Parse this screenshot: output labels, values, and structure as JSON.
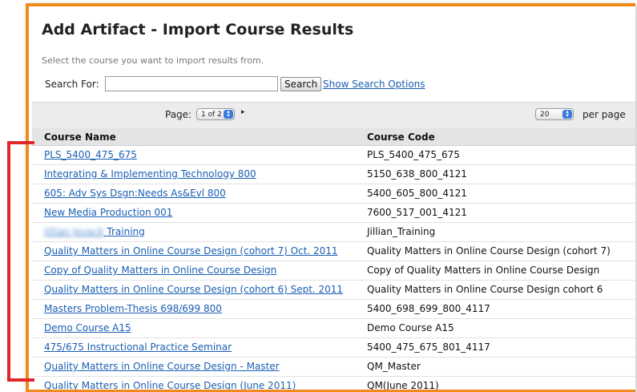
{
  "title": "Add Artifact - Import Course Results",
  "instructions": "Select the course you want to import results from.",
  "search": {
    "label": "Search For:",
    "value": "",
    "placeholder": "",
    "button_label": "Search",
    "options_link": "Show Search Options"
  },
  "pager": {
    "page_label": "Page:",
    "page_value": "1 of 2",
    "next_glyph": "▸",
    "per_page_value": "20",
    "per_page_label": "per page"
  },
  "table": {
    "columns": [
      "Course Name",
      "Course Code"
    ],
    "rows": [
      {
        "name": "PLS_5400_475_675",
        "code": "PLS_5400_475_675"
      },
      {
        "name": "Integrating & Implementing Technology 800",
        "code": "5150_638_800_4121"
      },
      {
        "name": "605: Adv Sys Dsgn:Needs As&Evl 800",
        "code": "5400_605_800_4121"
      },
      {
        "name": "New Media Production 001",
        "code": "7600_517_001_4121"
      },
      {
        "name_blurred": "Jillian Jevack",
        "name": "Training",
        "code": "Jillian_Training"
      },
      {
        "name": "Quality Matters in Online Course Design (cohort 7) Oct. 2011",
        "code": "Quality Matters in Online Course Design (cohort 7)"
      },
      {
        "name": "Copy of Quality Matters in Online Course Design",
        "code": "Copy of Quality Matters in Online Course Design"
      },
      {
        "name": "Quality Matters in Online Course Design (cohort 6) Sept. 2011",
        "code": "Quality Matters in Online Course Design cohort 6"
      },
      {
        "name": "Masters Problem-Thesis 698/699 800",
        "code": "5400_698_699_800_4117"
      },
      {
        "name": "Demo Course A15",
        "code": "Demo Course A15"
      },
      {
        "name": "475/675 Instructional Practice Seminar",
        "code": "5400_475_675_801_4117"
      },
      {
        "name": "Quality Matters in Online Course Design - Master",
        "code": "QM_Master"
      },
      {
        "name": "Quality Matters in Online Course Design (June 2011)",
        "code": "QM(June 2011)"
      }
    ]
  },
  "colors": {
    "frame": "#f08a1c",
    "link": "#1a5fb4",
    "annotation": "#e0282a"
  }
}
